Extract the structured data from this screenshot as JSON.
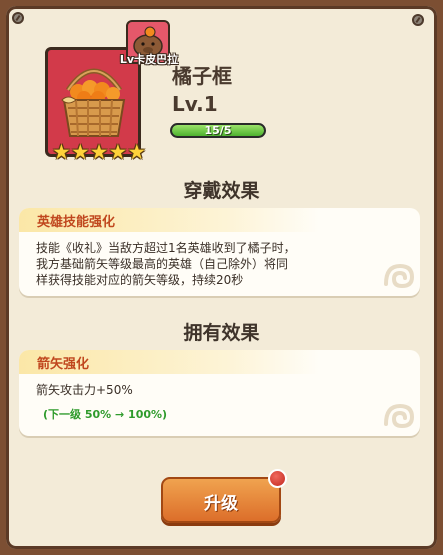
{
  "item": {
    "name": "橘子框",
    "level": "Lv.1",
    "progress_text": "15/5",
    "progress_fraction": 1.0,
    "stars": 5,
    "card_color": "#d23a4a"
  },
  "owner": {
    "label": "Lv卡皮巴拉",
    "icon": "capybara-avatar-icon"
  },
  "sections": {
    "wear_title": "穿戴效果",
    "own_title": "拥有效果"
  },
  "wear_effect": {
    "title": "英雄技能强化",
    "lines": [
      "技能《收礼》当敌方超过1名英雄收到了橘子时，",
      "我方基础箭矢等级最高的英雄（自己除外）将同",
      "样获得技能对应的箭矢等级，持续20秒"
    ]
  },
  "own_effect": {
    "title": "箭矢强化",
    "line": "箭矢攻击力+50%",
    "next": "(下一级 50% → 100%)"
  },
  "upgrade_button": {
    "label": "升级",
    "has_notification": true
  },
  "colors": {
    "accent": "#c0471e",
    "next_level": "#2f9b2c",
    "button": "#dc6e2a",
    "panel": "#f3ebd8"
  }
}
